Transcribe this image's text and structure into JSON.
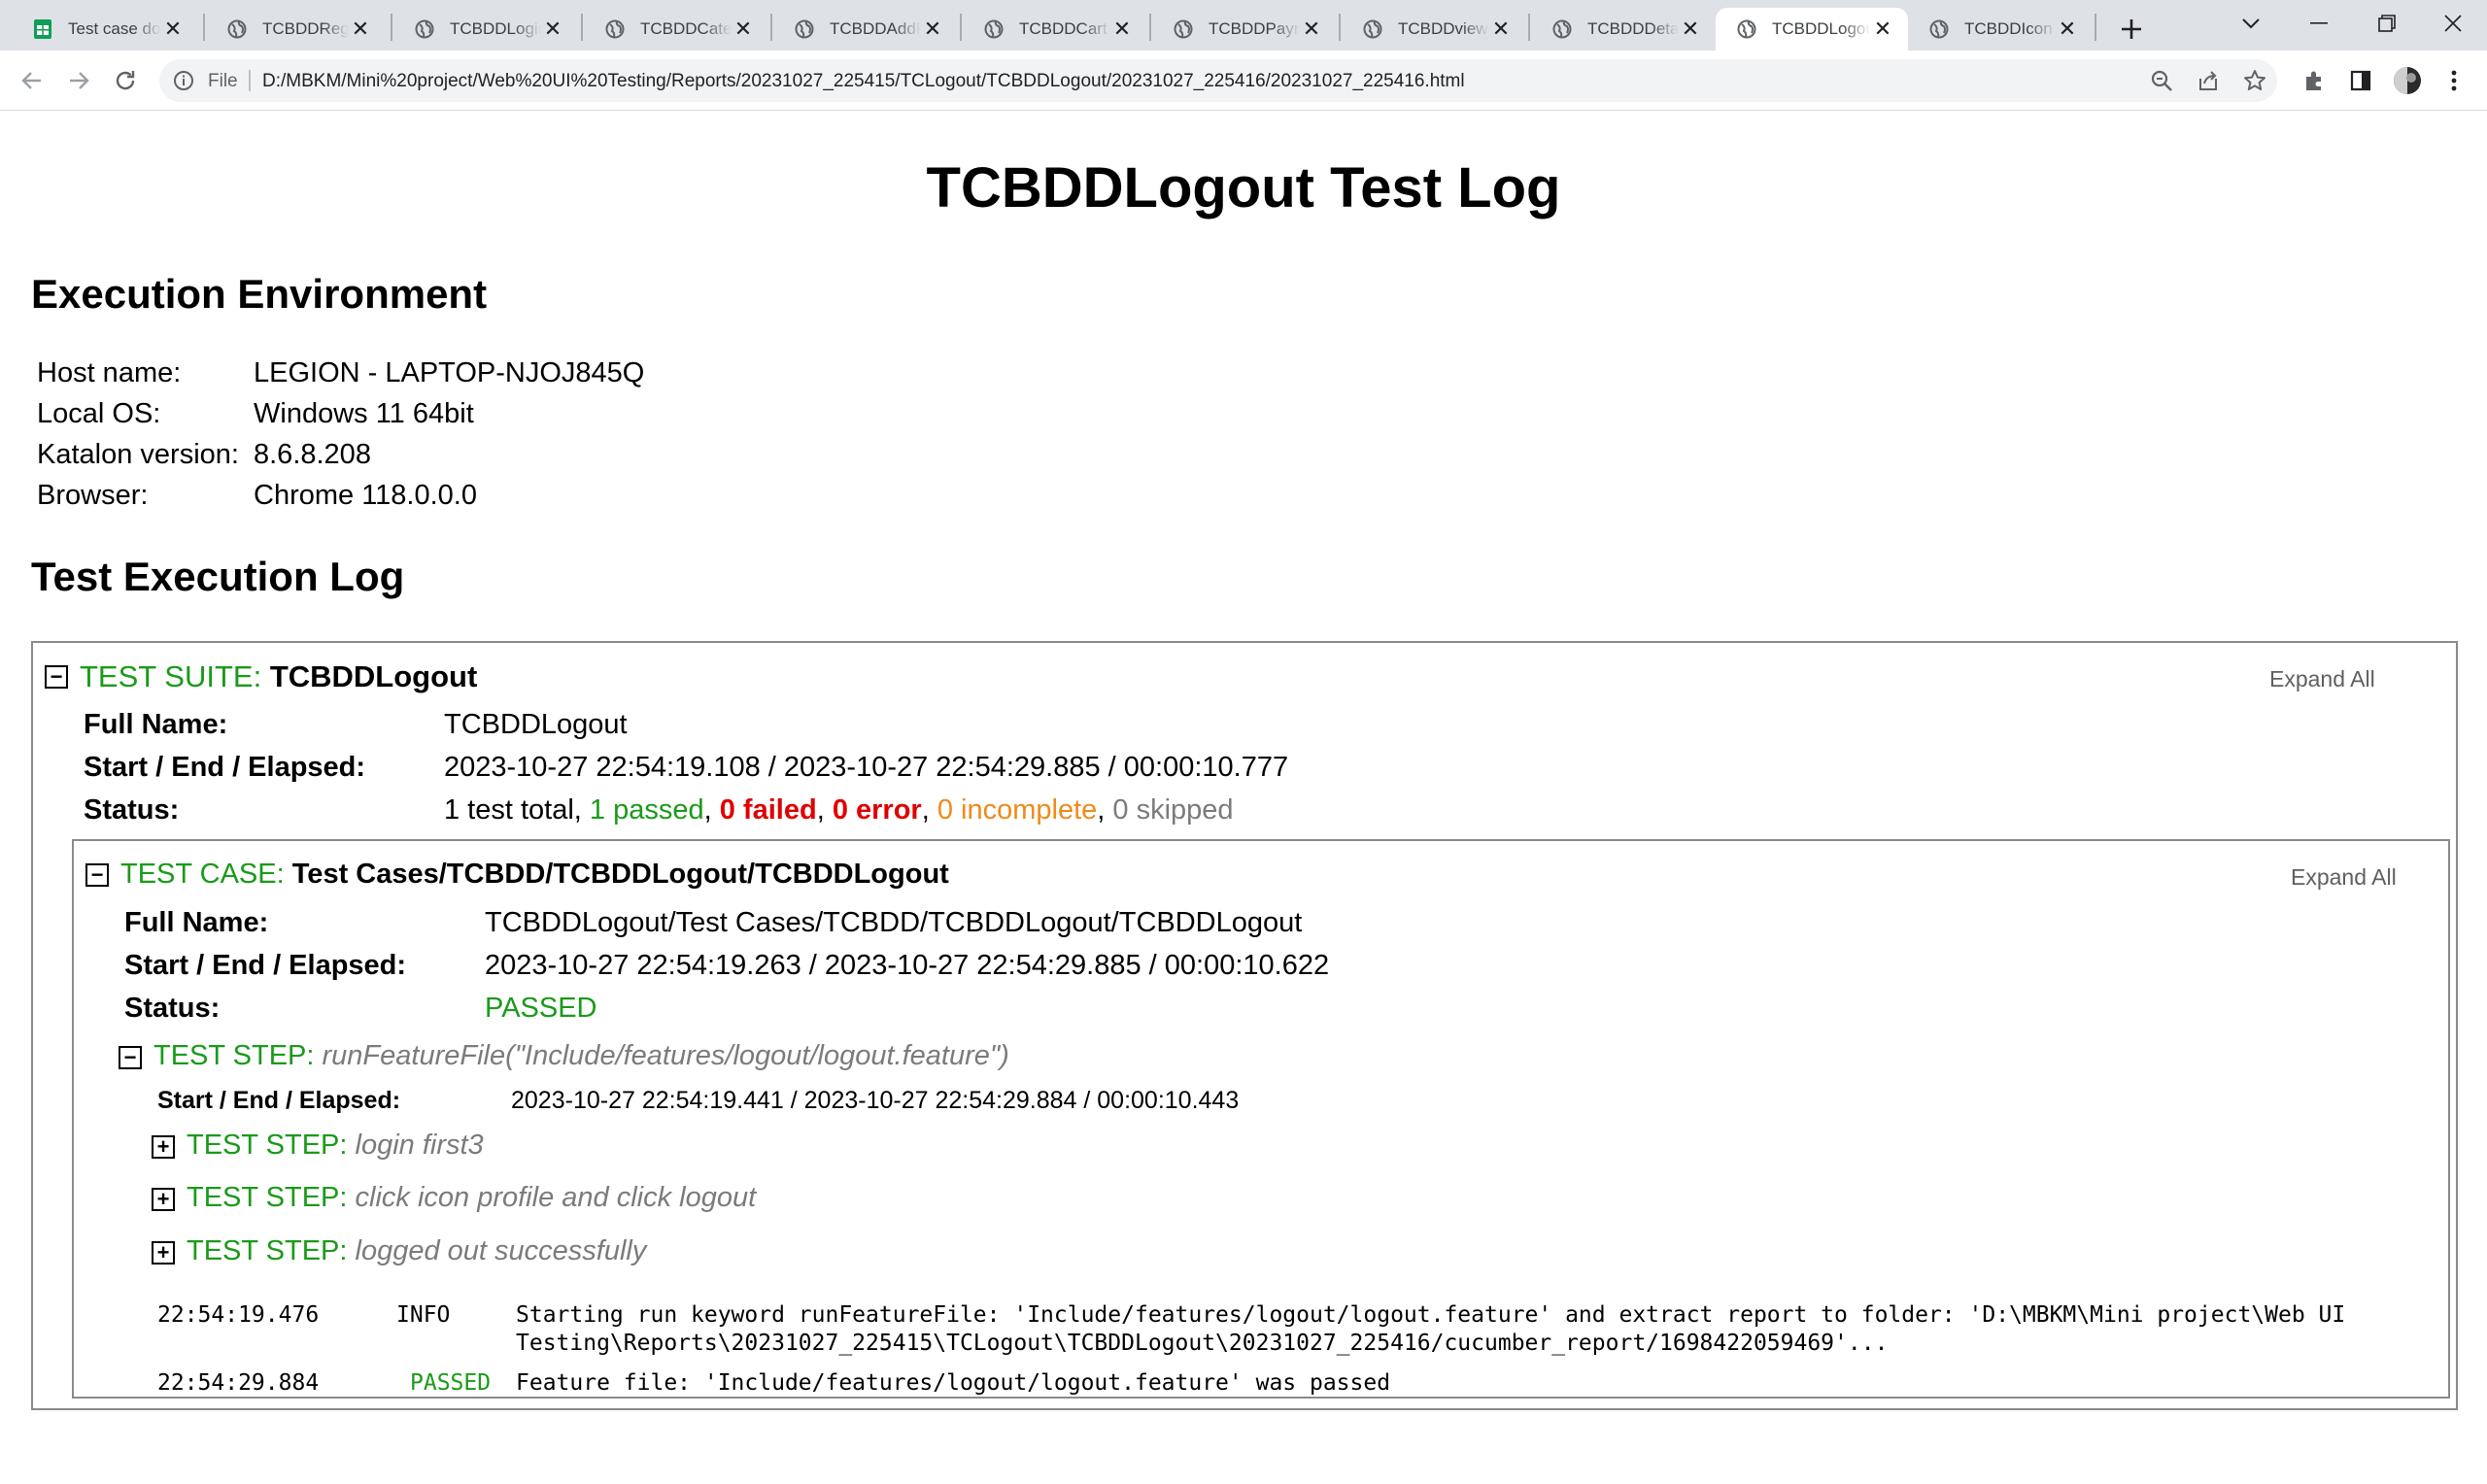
{
  "browser": {
    "tabs": [
      {
        "title": "Test case document",
        "icon": "sheets-icon",
        "active": false
      },
      {
        "title": "TCBDDRegister",
        "icon": "globe-icon",
        "active": false
      },
      {
        "title": "TCBDDLogin",
        "icon": "globe-icon",
        "active": false
      },
      {
        "title": "TCBDDCategory",
        "icon": "globe-icon",
        "active": false
      },
      {
        "title": "TCBDDAddProduct",
        "icon": "globe-icon",
        "active": false
      },
      {
        "title": "TCBDDCart",
        "icon": "globe-icon",
        "active": false
      },
      {
        "title": "TCBDDPayment",
        "icon": "globe-icon",
        "active": false
      },
      {
        "title": "TCBDDviewProduct",
        "icon": "globe-icon",
        "active": false
      },
      {
        "title": "TCBDDDetail",
        "icon": "globe-icon",
        "active": false
      },
      {
        "title": "TCBDDLogout",
        "icon": "globe-icon",
        "active": true
      },
      {
        "title": "TCBDDIcon",
        "icon": "globe-icon",
        "active": false
      }
    ],
    "address": {
      "scheme_label": "File",
      "url": "D:/MBKM/Mini%20project/Web%20UI%20Testing/Reports/20231027_225415/TCLogout/TCBDDLogout/20231027_225416/20231027_225416.html"
    }
  },
  "report": {
    "title": "TCBDDLogout Test Log",
    "env_heading": "Execution Environment",
    "environment": [
      {
        "label": "Host name:",
        "value": "LEGION - LAPTOP-NJOJ845Q"
      },
      {
        "label": "Local OS:",
        "value": "Windows 11 64bit"
      },
      {
        "label": "Katalon version:",
        "value": "8.6.8.208"
      },
      {
        "label": "Browser:",
        "value": "Chrome 118.0.0.0"
      }
    ],
    "log_heading": "Test Execution Log",
    "suite": {
      "prefix": "TEST SUITE:",
      "name": "TCBDDLogout",
      "expand_all": "Expand All",
      "full_name_label": "Full Name:",
      "full_name": "TCBDDLogout",
      "time_label": "Start / End / Elapsed:",
      "time": "2023-10-27 22:54:19.108 / 2023-10-27 22:54:29.885 / 00:00:10.777",
      "status_label": "Status:",
      "status": {
        "total": "1 test total,",
        "passed": "1 passed",
        "failed": "0 failed",
        "error": "0 error",
        "incomplete": "0 incomplete",
        "skipped": "0 skipped"
      }
    },
    "case": {
      "prefix": "TEST CASE:",
      "name": "Test Cases/TCBDD/TCBDDLogout/TCBDDLogout",
      "expand_all": "Expand All",
      "full_name_label": "Full Name:",
      "full_name": "TCBDDLogout/Test Cases/TCBDD/TCBDDLogout/TCBDDLogout",
      "time_label": "Start / End / Elapsed:",
      "time": "2023-10-27 22:54:19.263 / 2023-10-27 22:54:29.885 / 00:00:10.622",
      "status_label": "Status:",
      "status": "PASSED"
    },
    "step": {
      "prefix": "TEST STEP:",
      "name": "runFeatureFile(\"Include/features/logout/logout.feature\")",
      "time_label": "Start / End / Elapsed:",
      "time": "2023-10-27 22:54:19.441 / 2023-10-27 22:54:29.884 / 00:00:10.443",
      "substeps": [
        {
          "prefix": "TEST STEP:",
          "name": "login first3"
        },
        {
          "prefix": "TEST STEP:",
          "name": "click icon profile and click logout"
        },
        {
          "prefix": "TEST STEP:",
          "name": "logged out successfully"
        }
      ],
      "logs": [
        {
          "time": "22:54:19.476",
          "level": "INFO",
          "line1": "Starting run keyword runFeatureFile: 'Include/features/logout/logout.feature' and extract report to folder: 'D:\\MBKM\\Mini project\\Web UI",
          "line2": "Testing\\Reports\\20231027_225415\\TCLogout\\TCBDDLogout\\20231027_225416/cucumber_report/1698422059469'..."
        },
        {
          "time": "22:54:29.884",
          "level": "PASSED",
          "line1": "Feature file: 'Include/features/logout/logout.feature' was passed",
          "line2": ""
        }
      ]
    }
  },
  "colors": {
    "green": "#1a9a1a",
    "red": "#e00000",
    "orange": "#ef8a1a",
    "gray": "#7b7b7b"
  }
}
